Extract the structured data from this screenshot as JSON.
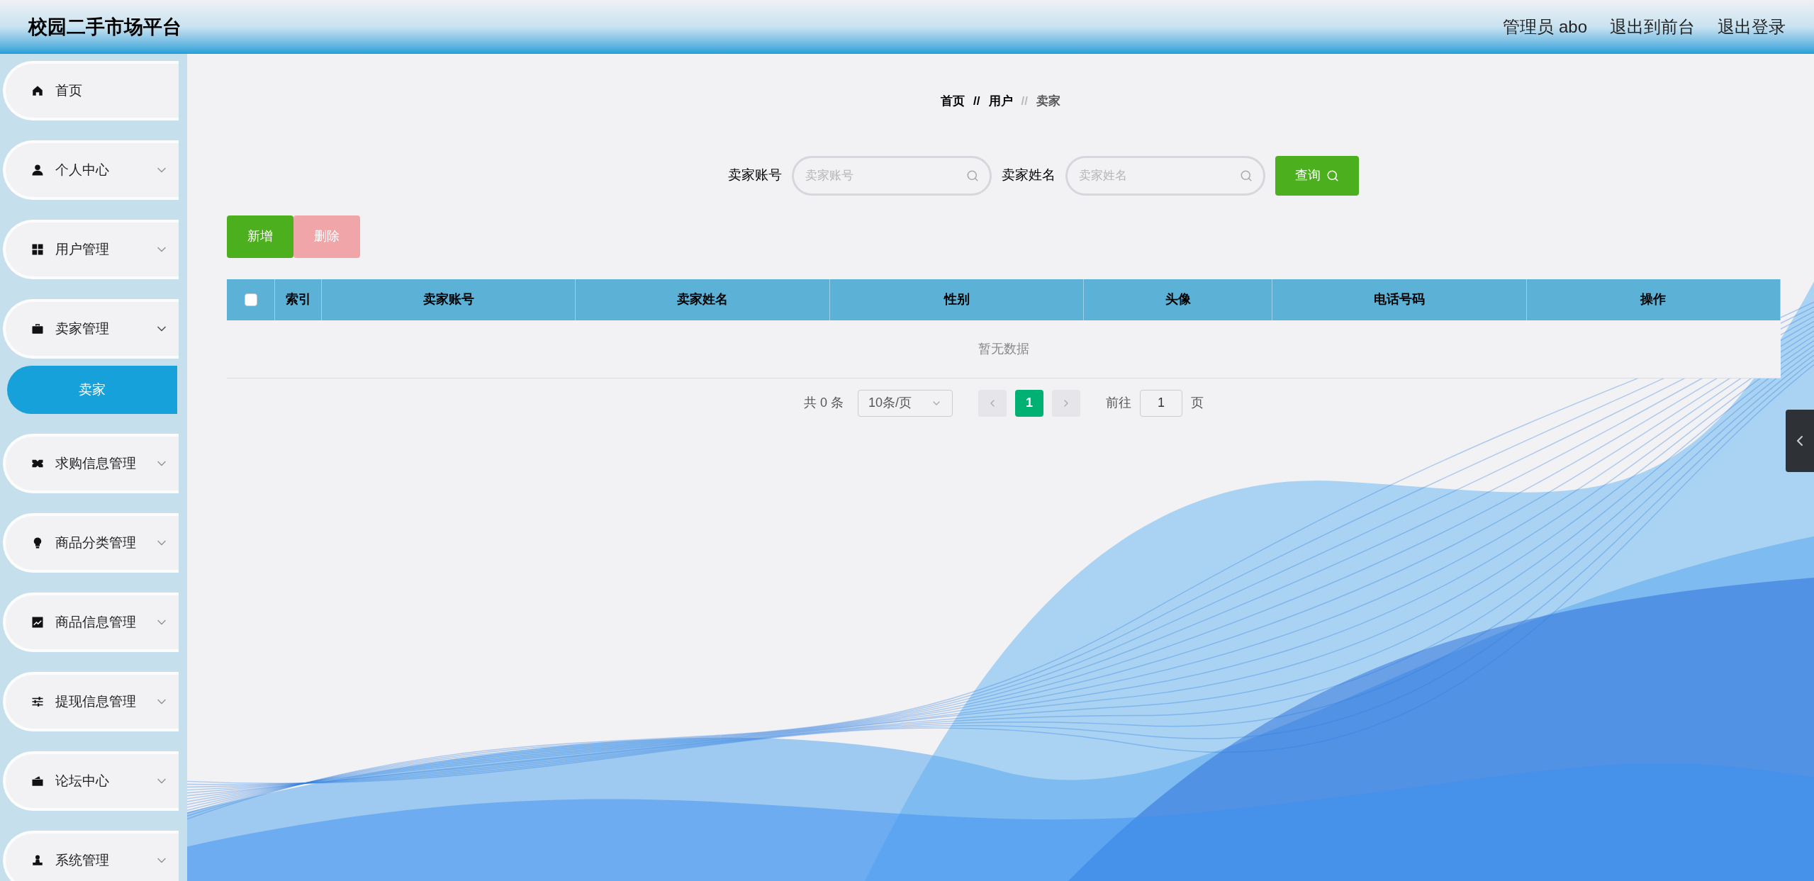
{
  "header": {
    "title": "校园二手市场平台",
    "links": [
      "管理员 abo",
      "退出到前台",
      "退出登录"
    ]
  },
  "sidebar": {
    "items": [
      {
        "label": "首页"
      },
      {
        "label": "个人中心",
        "expanded": false
      },
      {
        "label": "用户管理",
        "expanded": false
      },
      {
        "label": "卖家管理",
        "expanded": true,
        "children": [
          {
            "label": "卖家",
            "selected": true
          }
        ]
      },
      {
        "label": "求购信息管理",
        "expanded": false
      },
      {
        "label": "商品分类管理",
        "expanded": false
      },
      {
        "label": "商品信息管理",
        "expanded": false
      },
      {
        "label": "提现信息管理",
        "expanded": false
      },
      {
        "label": "论坛中心",
        "expanded": false
      },
      {
        "label": "系统管理",
        "expanded": false
      }
    ]
  },
  "breadcrumb": [
    "首页",
    "用户",
    "卖家"
  ],
  "breadcrumb_separator": "//",
  "search": {
    "fields": [
      {
        "label": "卖家账号",
        "placeholder": "卖家账号"
      },
      {
        "label": "卖家姓名",
        "placeholder": "卖家姓名"
      }
    ],
    "button": "查询"
  },
  "actions": [
    {
      "label": "新增",
      "disabled": false
    },
    {
      "label": "删除",
      "disabled": true
    }
  ],
  "table": {
    "select_all": {
      "checked": false
    },
    "columns": [
      "索引",
      "卖家账号",
      "卖家姓名",
      "性别",
      "头像",
      "电话号码",
      "操作"
    ],
    "empty_text": "暂无数据"
  },
  "pagination": {
    "total": "共 0 条",
    "page_size": "10条/页",
    "pages": [
      {
        "label": "1",
        "selected": true
      }
    ],
    "goto_label": "前往",
    "goto_value": "1",
    "goto_suffix": "页"
  }
}
